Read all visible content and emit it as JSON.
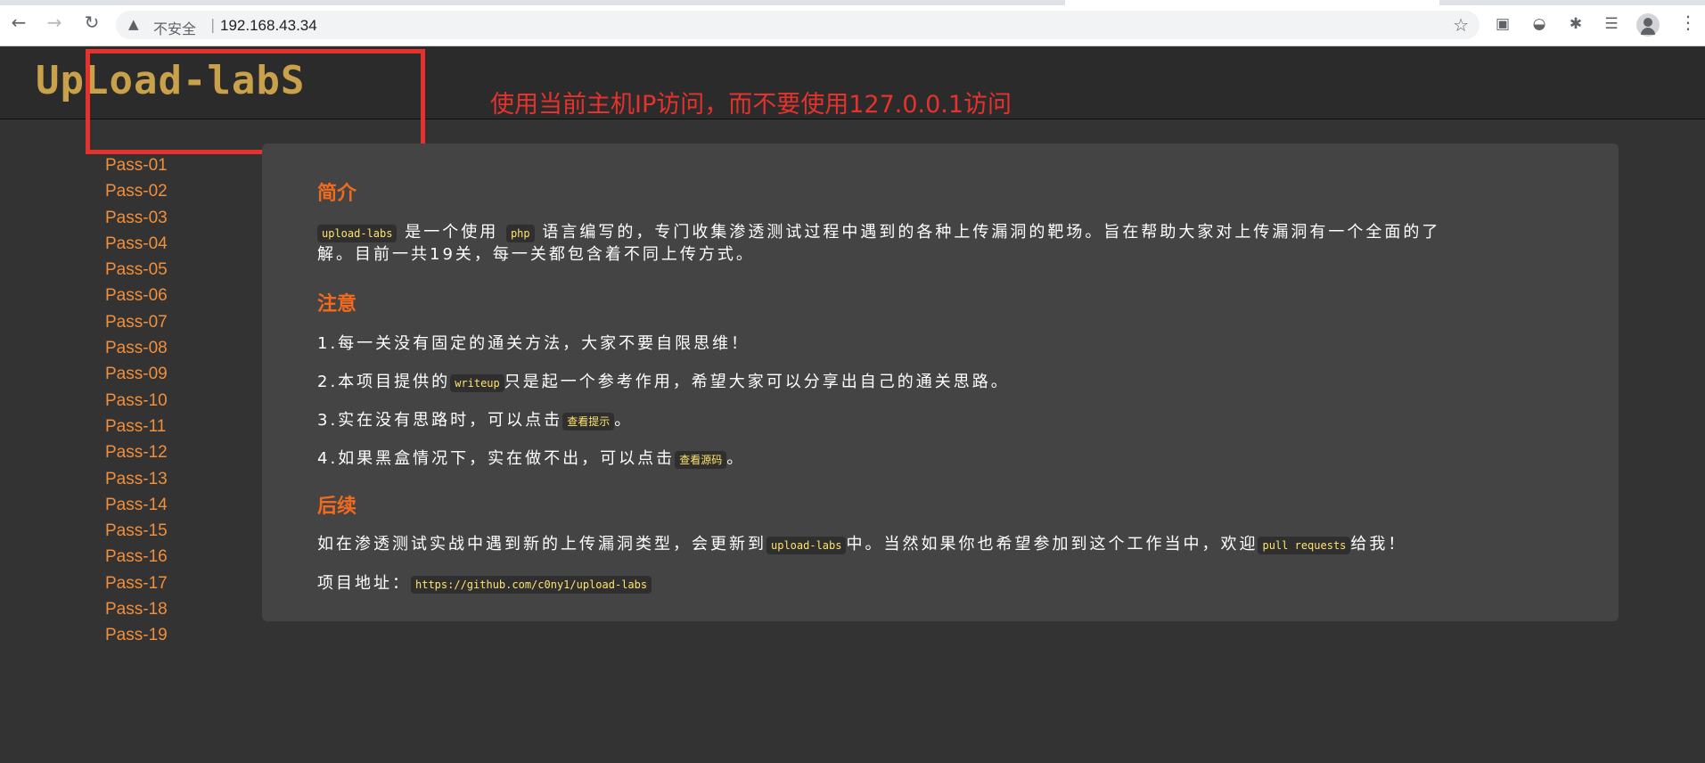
{
  "browser": {
    "security_label": "不安全",
    "separator": "|",
    "url": "192.168.43.34"
  },
  "site": {
    "logo_text": "UpLoad-labS",
    "annotation": "使用当前主机IP访问，而不要使用127.0.0.1访问"
  },
  "sidebar": {
    "items": [
      "Pass-01",
      "Pass-02",
      "Pass-03",
      "Pass-04",
      "Pass-05",
      "Pass-06",
      "Pass-07",
      "Pass-08",
      "Pass-09",
      "Pass-10",
      "Pass-11",
      "Pass-12",
      "Pass-13",
      "Pass-14",
      "Pass-15",
      "Pass-16",
      "Pass-17",
      "Pass-18",
      "Pass-19"
    ]
  },
  "main": {
    "intro_title": "简介",
    "intro_code1": "upload-labs",
    "intro_t1": "是一个使用",
    "intro_code2": "php",
    "intro_t2": "语言编写的，专门收集渗透测试过程中遇到的各种上传漏洞的靶场。旨在帮助大家对上传漏洞有一个全面的了",
    "intro_t3": "解。目前一共19关，每一关都包含着不同上传方式。",
    "note_title": "注意",
    "note1": "1.每一关没有固定的通关方法，大家不要自限思维！",
    "note2_a": "2.本项目提供的",
    "note2_code": "writeup",
    "note2_b": "只是起一个参考作用，希望大家可以分享出自己的通关思路。",
    "note3_a": "3.实在没有思路时，可以点击",
    "note3_btn": "查看提示",
    "note3_b": "。",
    "note4_a": "4.如果黑盒情况下，实在做不出，可以点击",
    "note4_btn": "查看源码",
    "note4_b": "。",
    "follow_title": "后续",
    "follow_a": "如在渗透测试实战中遇到新的上传漏洞类型，会更新到",
    "follow_code1": "upload-labs",
    "follow_b": "中。当然如果你也希望参加到这个工作当中，欢迎",
    "follow_code2": "pull requests",
    "follow_c": "给我！",
    "addr_label": "项目地址：",
    "addr_url": "https://github.com/c0ny1/upload-labs"
  },
  "colors": {
    "accent_orange": "#f26b1d",
    "link_orange": "#f18f3b",
    "code_yellow": "#ffe36b",
    "annotation_red": "#e5322d"
  }
}
